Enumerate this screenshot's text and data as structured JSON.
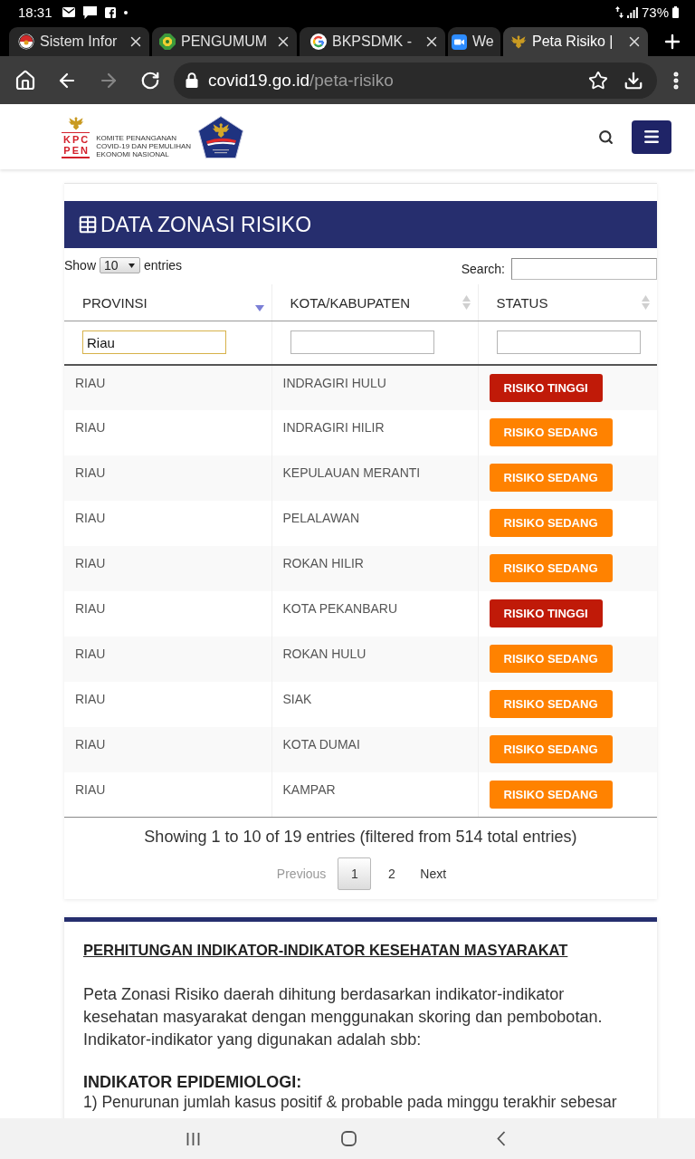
{
  "status_bar": {
    "time": "18:31",
    "battery": "73%"
  },
  "browser": {
    "tabs": [
      {
        "title": "Sistem Infor",
        "selected": false,
        "has_close": true
      },
      {
        "title": "PENGUMUM",
        "selected": false,
        "has_close": true
      },
      {
        "title": "BKPSDMK -",
        "selected": false,
        "has_close": true
      },
      {
        "title": "We",
        "selected": false,
        "has_close": false
      },
      {
        "title": "Peta Risiko |",
        "selected": true,
        "has_close": true
      }
    ],
    "toolbar": {
      "forward_disabled": true
    },
    "address_bar": {
      "host": "covid19.go.id",
      "path": "/peta-risiko"
    }
  },
  "site_header": {
    "logo_letters": [
      "KPC",
      "PEN"
    ],
    "logo_caption": [
      "KOMITE PENANGANAN",
      "COVID-19 DAN PEMULIHAN",
      "EKONOMI NASIONAL"
    ]
  },
  "data_table": {
    "title": "DATA ZONASI RISIKO",
    "length_prefix": "Show",
    "length_value": "10",
    "length_suffix": "entries",
    "search_label": "Search:",
    "columns": [
      {
        "label": "PROVINSI",
        "sorted": true
      },
      {
        "label": "KOTA/KABUPATEN",
        "sorted": false
      },
      {
        "label": "STATUS",
        "sorted": false
      }
    ],
    "filters": [
      {
        "value": "Riau",
        "focused": true
      },
      {
        "focused": false
      },
      {
        "focused": false
      }
    ],
    "rows": [
      {
        "provinsi": "RIAU",
        "kota": "INDRAGIRI HULU",
        "status": "RISIKO TINGGI",
        "color": "#c01a08"
      },
      {
        "provinsi": "RIAU",
        "kota": "INDRAGIRI HILIR",
        "status": "RISIKO SEDANG",
        "color": "#ff8200"
      },
      {
        "provinsi": "RIAU",
        "kota": "KEPULAUAN MERANTI",
        "status": "RISIKO SEDANG",
        "color": "#ff8200"
      },
      {
        "provinsi": "RIAU",
        "kota": "PELALAWAN",
        "status": "RISIKO SEDANG",
        "color": "#ff8200"
      },
      {
        "provinsi": "RIAU",
        "kota": "ROKAN HILIR",
        "status": "RISIKO SEDANG",
        "color": "#ff8200"
      },
      {
        "provinsi": "RIAU",
        "kota": "KOTA PEKANBARU",
        "status": "RISIKO TINGGI",
        "color": "#c01a08"
      },
      {
        "provinsi": "RIAU",
        "kota": "ROKAN HULU",
        "status": "RISIKO SEDANG",
        "color": "#ff8200"
      },
      {
        "provinsi": "RIAU",
        "kota": "SIAK",
        "status": "RISIKO SEDANG",
        "color": "#ff8200"
      },
      {
        "provinsi": "RIAU",
        "kota": "KOTA DUMAI",
        "status": "RISIKO SEDANG",
        "color": "#ff8200"
      },
      {
        "provinsi": "RIAU",
        "kota": "KAMPAR",
        "status": "RISIKO SEDANG",
        "color": "#ff8200"
      }
    ],
    "info": "Showing 1 to 10 of 19 entries (filtered from 514 total entries)",
    "pagination": {
      "previous": {
        "label": "Previous",
        "disabled": true
      },
      "pages": [
        {
          "label": "1",
          "selected": true
        },
        {
          "label": "2",
          "selected": false
        }
      ],
      "next": {
        "label": "Next",
        "disabled": false
      }
    }
  },
  "info_card": {
    "heading": "PERHITUNGAN INDIKATOR-INDIKATOR KESEHATAN MASYARAKAT",
    "paragraph": "Peta Zonasi Risiko daerah dihitung berdasarkan indikator-indikator kesehatan masyarakat dengan menggunakan skoring dan pembobotan. Indikator-indikator yang digunakan adalah sbb:",
    "subheading": "INDIKATOR EPIDEMIOLOGI:",
    "items": [
      "1) Penurunan jumlah kasus positif & probable pada minggu terakhir sebesar"
    ]
  }
}
